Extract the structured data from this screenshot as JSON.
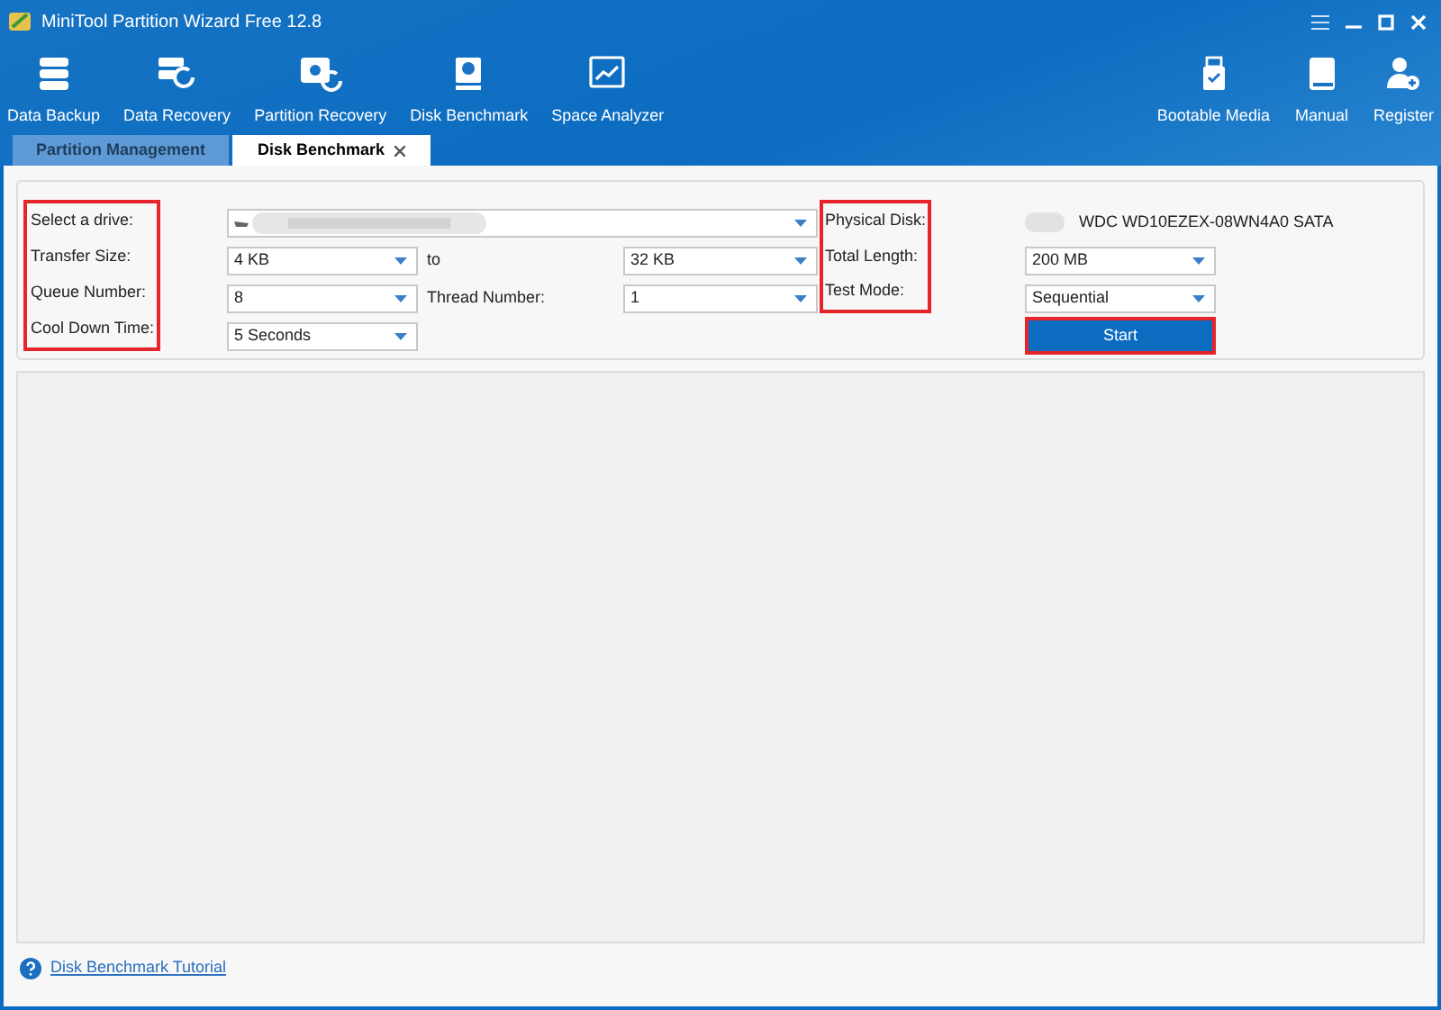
{
  "window": {
    "title": "MiniTool Partition Wizard Free 12.8"
  },
  "toolbar": {
    "left": [
      {
        "label": "Data Backup",
        "kind": "backup"
      },
      {
        "label": "Data Recovery",
        "kind": "recovery"
      },
      {
        "label": "Partition Recovery",
        "kind": "partition"
      },
      {
        "label": "Disk Benchmark",
        "kind": "disk"
      },
      {
        "label": "Space Analyzer",
        "kind": "analyzer"
      }
    ],
    "right": [
      {
        "label": "Bootable Media",
        "kind": "usb"
      },
      {
        "label": "Manual",
        "kind": "book"
      },
      {
        "label": "Register",
        "kind": "user"
      }
    ]
  },
  "tabs": [
    {
      "label": "Partition Management",
      "selected": false,
      "closable": false
    },
    {
      "label": "Disk Benchmark",
      "selected": true,
      "closable": true
    }
  ],
  "benchmark": {
    "left_labels": {
      "highlighted": true,
      "items": [
        "Select a drive:",
        "Transfer Size:",
        "Queue Number:",
        "Cool Down Time:"
      ]
    },
    "transfer_from": "4 KB",
    "to_label": "to",
    "transfer_to": "32 KB",
    "queue": "8",
    "thread_label": "Thread Number:",
    "thread": "1",
    "cool_down": "5 Seconds",
    "right_labels": {
      "highlighted": true,
      "items": [
        "Physical Disk:",
        "Total Length:",
        "Test Mode:"
      ]
    },
    "physical_disk": "WDC WD10EZEX-08WN4A0 SATA",
    "total_length": "200 MB",
    "test_mode": "Sequential",
    "start_button": {
      "label": "Start",
      "highlighted": true
    }
  },
  "footer": {
    "link": "Disk Benchmark Tutorial"
  }
}
